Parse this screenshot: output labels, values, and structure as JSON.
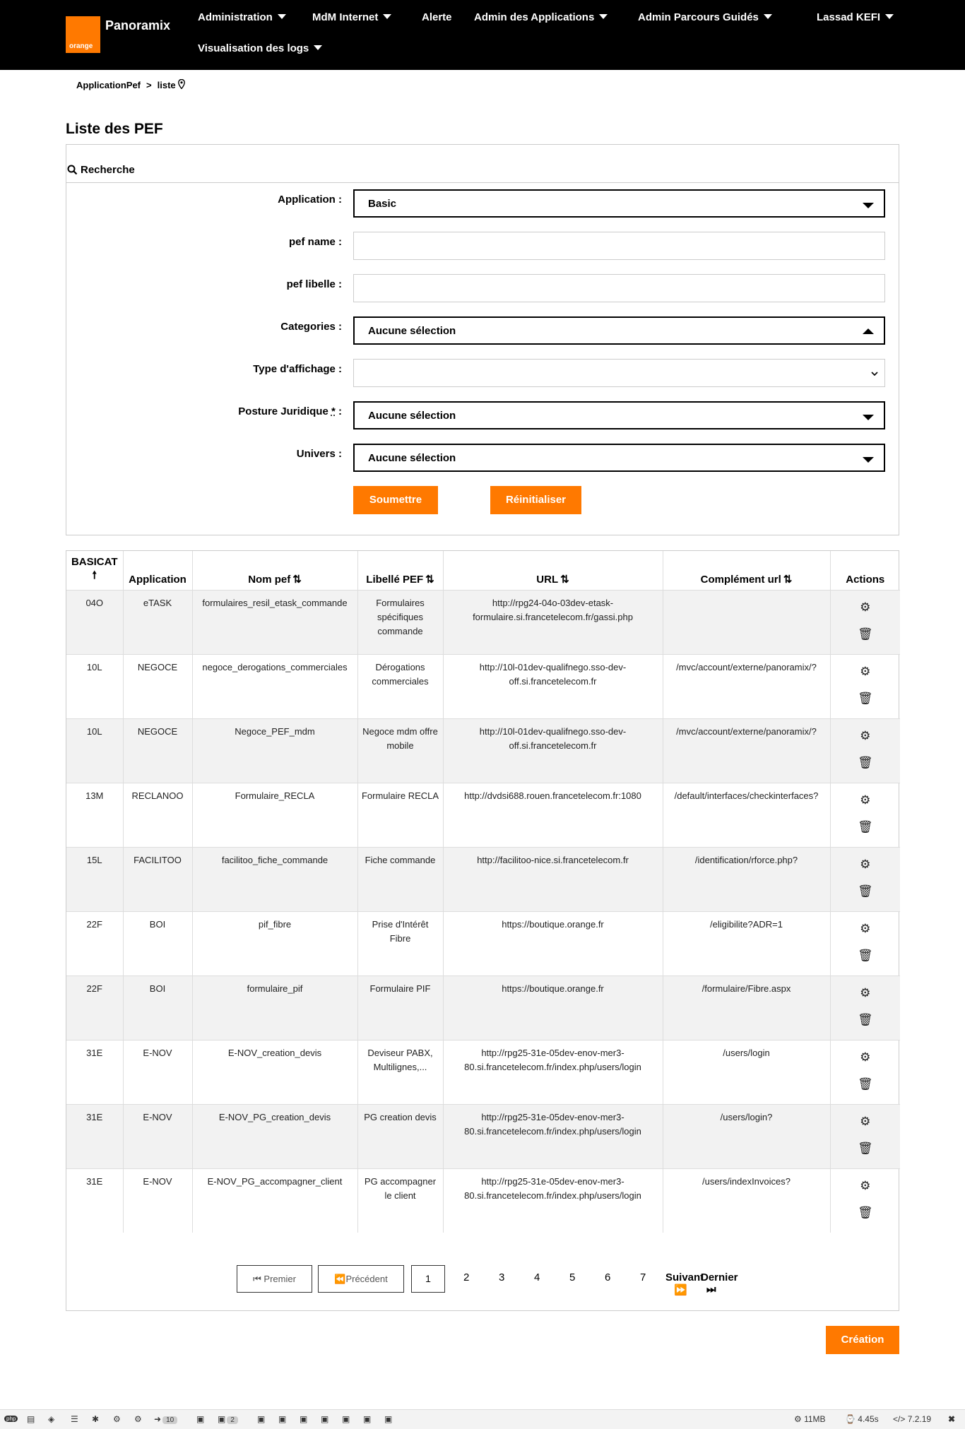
{
  "app": {
    "brand": "Panoramix",
    "logo_text": "orange",
    "accent": "#ff7900"
  },
  "nav": {
    "items": [
      {
        "label": "Administration"
      },
      {
        "label": "MdM Internet"
      },
      {
        "label": "Alerte"
      },
      {
        "label": "Admin des Applications"
      },
      {
        "label": "Admin Parcours Guidés"
      },
      {
        "label": "Visualisation des logs"
      }
    ],
    "user": "Lassad KEFI"
  },
  "breadcrumb": {
    "items": [
      "ApplicationPef",
      "liste"
    ],
    "separator": ">",
    "icon": "map-marker-icon"
  },
  "page": {
    "title": "Liste des PEF"
  },
  "search": {
    "header": "Recherche",
    "fields": {
      "application": {
        "label": "Application :",
        "value": "Basic"
      },
      "pef_name": {
        "label": "pef name :",
        "value": ""
      },
      "pef_libelle": {
        "label": "pef libelle :",
        "value": ""
      },
      "categories": {
        "label": "Categories :",
        "value": "Aucune sélection"
      },
      "type_affichage": {
        "label": "Type d'affichage :",
        "value": ""
      },
      "posture": {
        "label": "Posture Juridique",
        "req": "*",
        "suffix": ":",
        "value": "Aucune sélection"
      },
      "univers": {
        "label": "Univers :",
        "value": "Aucune sélection"
      }
    },
    "submit": "Soumettre",
    "reset": "Réinitialiser"
  },
  "table": {
    "headers": {
      "basicat": "BASICAT",
      "application": "Application",
      "nom_pef": "Nom pef",
      "libelle": "Libellé PEF",
      "url": "URL",
      "complement": "Complément url",
      "actions": "Actions"
    },
    "rows": [
      {
        "basicat": "04O",
        "application": "eTASK",
        "nom": "formulaires_resil_etask_commande",
        "libelle": "Formulaires spécifiques commande",
        "url": "http://rpg24-04o-03dev-etask-formulaire.si.francetelecom.fr/gassi.php",
        "complement": ""
      },
      {
        "basicat": "10L",
        "application": "NEGOCE",
        "nom": "negoce_derogations_commerciales",
        "libelle": "Dérogations commerciales",
        "url": "http://10l-01dev-qualifnego.sso-dev-off.si.francetelecom.fr",
        "complement": "/mvc/account/externe/panoramix/?"
      },
      {
        "basicat": "10L",
        "application": "NEGOCE",
        "nom": "Negoce_PEF_mdm",
        "libelle": "Negoce mdm offre mobile",
        "url": "http://10l-01dev-qualifnego.sso-dev-off.si.francetelecom.fr",
        "complement": "/mvc/account/externe/panoramix/?"
      },
      {
        "basicat": "13M",
        "application": "RECLANOO",
        "nom": "Formulaire_RECLA",
        "libelle": "Formulaire RECLA",
        "url": "http://dvdsi688.rouen.francetelecom.fr:1080",
        "complement": "/default/interfaces/checkinterfaces?"
      },
      {
        "basicat": "15L",
        "application": "FACILITOO",
        "nom": "facilitoo_fiche_commande",
        "libelle": "Fiche commande",
        "url": "http://facilitoo-nice.si.francetelecom.fr",
        "complement": "/identification/rforce.php?"
      },
      {
        "basicat": "22F",
        "application": "BOI",
        "nom": "pif_fibre",
        "libelle": "Prise d'Intérêt Fibre",
        "url": "https://boutique.orange.fr",
        "complement": "/eligibilite?ADR=1"
      },
      {
        "basicat": "22F",
        "application": "BOI",
        "nom": "formulaire_pif",
        "libelle": "Formulaire PIF",
        "url": "https://boutique.orange.fr",
        "complement": "/formulaire/Fibre.aspx"
      },
      {
        "basicat": "31E",
        "application": "E-NOV",
        "nom": "E-NOV_creation_devis",
        "libelle": "Deviseur PABX, Multilignes,...",
        "url": "http://rpg25-31e-05dev-enov-mer3-80.si.francetelecom.fr/index.php/users/login",
        "complement": "/users/login"
      },
      {
        "basicat": "31E",
        "application": "E-NOV",
        "nom": "E-NOV_PG_creation_devis",
        "libelle": "PG creation devis",
        "url": "http://rpg25-31e-05dev-enov-mer3-80.si.francetelecom.fr/index.php/users/login",
        "complement": "/users/login?"
      },
      {
        "basicat": "31E",
        "application": "E-NOV",
        "nom": "E-NOV_PG_accompagner_client",
        "libelle": "PG accompagner le client",
        "url": "http://rpg25-31e-05dev-enov-mer3-80.si.francetelecom.fr/index.php/users/login",
        "complement": "/users/indexInvoices?"
      }
    ]
  },
  "pagination": {
    "first": "Premier",
    "prev": "Précédent",
    "pages": [
      "1",
      "2",
      "3",
      "4",
      "5",
      "6",
      "7"
    ],
    "current": "1",
    "next": "Suivant",
    "last": "Dernier"
  },
  "create_button": "Création",
  "debugbar": {
    "badge1": "10",
    "badge2": "2",
    "memory": "11MB",
    "time": "4.45s",
    "php": "7.2.19"
  }
}
